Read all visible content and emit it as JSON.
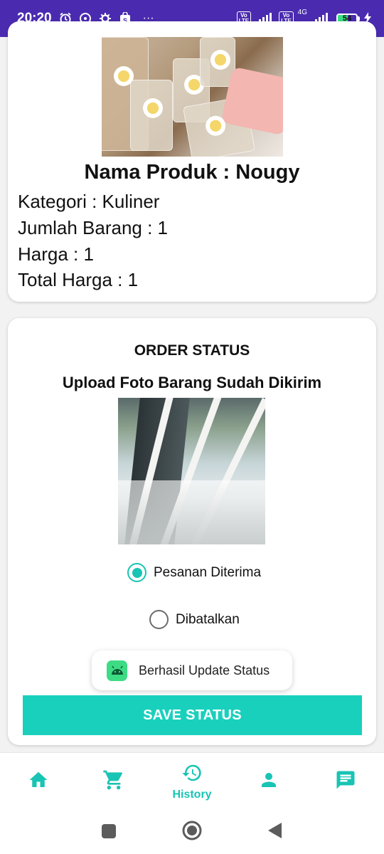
{
  "status_bar": {
    "time": "20:20",
    "more": "···",
    "network_type": "4G",
    "volte_label": "Vo LTE",
    "battery": "54"
  },
  "product": {
    "title": "Nama Produk : Nougy",
    "category": "Kategori : Kuliner",
    "quantity": "Jumlah Barang : 1",
    "price": "Harga : 1",
    "total": "Total Harga : 1"
  },
  "order_status": {
    "title": "ORDER STATUS",
    "upload_label": "Upload Foto Barang Sudah Dikirim",
    "options": [
      {
        "label": "Pesanan Diterima",
        "selected": true
      },
      {
        "label": "Dibatalkan",
        "selected": false
      }
    ],
    "toast": "Berhasil Update Status",
    "save_label": "SAVE STATUS"
  },
  "bottom_nav": {
    "items": [
      {
        "icon": "home-icon",
        "label": ""
      },
      {
        "icon": "cart-icon",
        "label": ""
      },
      {
        "icon": "history-icon",
        "label": "History"
      },
      {
        "icon": "person-icon",
        "label": ""
      },
      {
        "icon": "chat-icon",
        "label": ""
      }
    ]
  },
  "colors": {
    "accent": "#19c4b4",
    "status_bar": "#4a2bb0",
    "button": "#19d0bd"
  }
}
